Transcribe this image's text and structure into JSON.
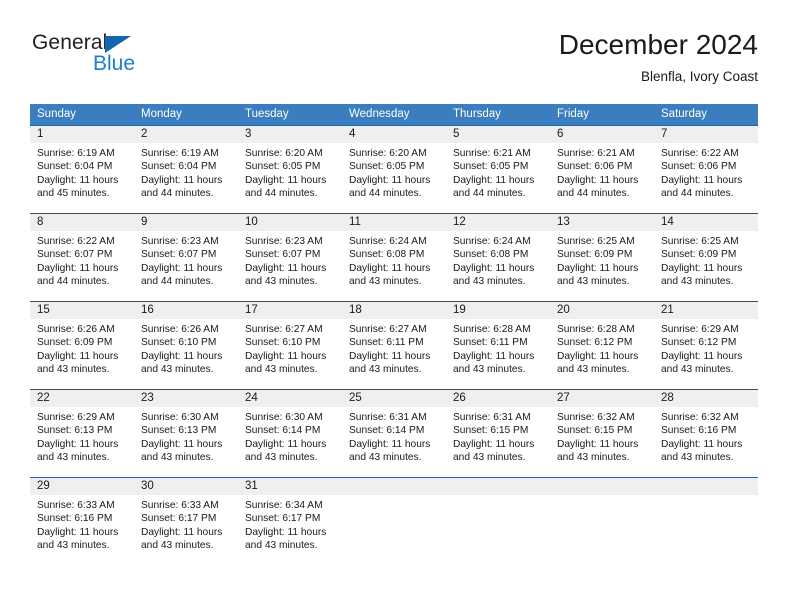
{
  "logo": {
    "text_top": "General",
    "text_bottom": "Blue",
    "triangle_color": "#1266b0",
    "blue_color": "#1b7fd1"
  },
  "header": {
    "title": "December 2024",
    "subtitle": "Blenfla, Ivory Coast"
  },
  "theme": {
    "header_bg": "#3a7ebf",
    "header_text": "#ffffff",
    "daynum_band_bg": "#efefef",
    "rule_color": "#1f69b3"
  },
  "calendar": {
    "weekday_headers": [
      "Sunday",
      "Monday",
      "Tuesday",
      "Wednesday",
      "Thursday",
      "Friday",
      "Saturday"
    ],
    "weeks": [
      [
        {
          "day": "1",
          "sunrise": "Sunrise: 6:19 AM",
          "sunset": "Sunset: 6:04 PM",
          "daylight1": "Daylight: 11 hours",
          "daylight2": "and 45 minutes."
        },
        {
          "day": "2",
          "sunrise": "Sunrise: 6:19 AM",
          "sunset": "Sunset: 6:04 PM",
          "daylight1": "Daylight: 11 hours",
          "daylight2": "and 44 minutes."
        },
        {
          "day": "3",
          "sunrise": "Sunrise: 6:20 AM",
          "sunset": "Sunset: 6:05 PM",
          "daylight1": "Daylight: 11 hours",
          "daylight2": "and 44 minutes."
        },
        {
          "day": "4",
          "sunrise": "Sunrise: 6:20 AM",
          "sunset": "Sunset: 6:05 PM",
          "daylight1": "Daylight: 11 hours",
          "daylight2": "and 44 minutes."
        },
        {
          "day": "5",
          "sunrise": "Sunrise: 6:21 AM",
          "sunset": "Sunset: 6:05 PM",
          "daylight1": "Daylight: 11 hours",
          "daylight2": "and 44 minutes."
        },
        {
          "day": "6",
          "sunrise": "Sunrise: 6:21 AM",
          "sunset": "Sunset: 6:06 PM",
          "daylight1": "Daylight: 11 hours",
          "daylight2": "and 44 minutes."
        },
        {
          "day": "7",
          "sunrise": "Sunrise: 6:22 AM",
          "sunset": "Sunset: 6:06 PM",
          "daylight1": "Daylight: 11 hours",
          "daylight2": "and 44 minutes."
        }
      ],
      [
        {
          "day": "8",
          "sunrise": "Sunrise: 6:22 AM",
          "sunset": "Sunset: 6:07 PM",
          "daylight1": "Daylight: 11 hours",
          "daylight2": "and 44 minutes."
        },
        {
          "day": "9",
          "sunrise": "Sunrise: 6:23 AM",
          "sunset": "Sunset: 6:07 PM",
          "daylight1": "Daylight: 11 hours",
          "daylight2": "and 44 minutes."
        },
        {
          "day": "10",
          "sunrise": "Sunrise: 6:23 AM",
          "sunset": "Sunset: 6:07 PM",
          "daylight1": "Daylight: 11 hours",
          "daylight2": "and 43 minutes."
        },
        {
          "day": "11",
          "sunrise": "Sunrise: 6:24 AM",
          "sunset": "Sunset: 6:08 PM",
          "daylight1": "Daylight: 11 hours",
          "daylight2": "and 43 minutes."
        },
        {
          "day": "12",
          "sunrise": "Sunrise: 6:24 AM",
          "sunset": "Sunset: 6:08 PM",
          "daylight1": "Daylight: 11 hours",
          "daylight2": "and 43 minutes."
        },
        {
          "day": "13",
          "sunrise": "Sunrise: 6:25 AM",
          "sunset": "Sunset: 6:09 PM",
          "daylight1": "Daylight: 11 hours",
          "daylight2": "and 43 minutes."
        },
        {
          "day": "14",
          "sunrise": "Sunrise: 6:25 AM",
          "sunset": "Sunset: 6:09 PM",
          "daylight1": "Daylight: 11 hours",
          "daylight2": "and 43 minutes."
        }
      ],
      [
        {
          "day": "15",
          "sunrise": "Sunrise: 6:26 AM",
          "sunset": "Sunset: 6:09 PM",
          "daylight1": "Daylight: 11 hours",
          "daylight2": "and 43 minutes."
        },
        {
          "day": "16",
          "sunrise": "Sunrise: 6:26 AM",
          "sunset": "Sunset: 6:10 PM",
          "daylight1": "Daylight: 11 hours",
          "daylight2": "and 43 minutes."
        },
        {
          "day": "17",
          "sunrise": "Sunrise: 6:27 AM",
          "sunset": "Sunset: 6:10 PM",
          "daylight1": "Daylight: 11 hours",
          "daylight2": "and 43 minutes."
        },
        {
          "day": "18",
          "sunrise": "Sunrise: 6:27 AM",
          "sunset": "Sunset: 6:11 PM",
          "daylight1": "Daylight: 11 hours",
          "daylight2": "and 43 minutes."
        },
        {
          "day": "19",
          "sunrise": "Sunrise: 6:28 AM",
          "sunset": "Sunset: 6:11 PM",
          "daylight1": "Daylight: 11 hours",
          "daylight2": "and 43 minutes."
        },
        {
          "day": "20",
          "sunrise": "Sunrise: 6:28 AM",
          "sunset": "Sunset: 6:12 PM",
          "daylight1": "Daylight: 11 hours",
          "daylight2": "and 43 minutes."
        },
        {
          "day": "21",
          "sunrise": "Sunrise: 6:29 AM",
          "sunset": "Sunset: 6:12 PM",
          "daylight1": "Daylight: 11 hours",
          "daylight2": "and 43 minutes."
        }
      ],
      [
        {
          "day": "22",
          "sunrise": "Sunrise: 6:29 AM",
          "sunset": "Sunset: 6:13 PM",
          "daylight1": "Daylight: 11 hours",
          "daylight2": "and 43 minutes."
        },
        {
          "day": "23",
          "sunrise": "Sunrise: 6:30 AM",
          "sunset": "Sunset: 6:13 PM",
          "daylight1": "Daylight: 11 hours",
          "daylight2": "and 43 minutes."
        },
        {
          "day": "24",
          "sunrise": "Sunrise: 6:30 AM",
          "sunset": "Sunset: 6:14 PM",
          "daylight1": "Daylight: 11 hours",
          "daylight2": "and 43 minutes."
        },
        {
          "day": "25",
          "sunrise": "Sunrise: 6:31 AM",
          "sunset": "Sunset: 6:14 PM",
          "daylight1": "Daylight: 11 hours",
          "daylight2": "and 43 minutes."
        },
        {
          "day": "26",
          "sunrise": "Sunrise: 6:31 AM",
          "sunset": "Sunset: 6:15 PM",
          "daylight1": "Daylight: 11 hours",
          "daylight2": "and 43 minutes."
        },
        {
          "day": "27",
          "sunrise": "Sunrise: 6:32 AM",
          "sunset": "Sunset: 6:15 PM",
          "daylight1": "Daylight: 11 hours",
          "daylight2": "and 43 minutes."
        },
        {
          "day": "28",
          "sunrise": "Sunrise: 6:32 AM",
          "sunset": "Sunset: 6:16 PM",
          "daylight1": "Daylight: 11 hours",
          "daylight2": "and 43 minutes."
        }
      ],
      [
        {
          "day": "29",
          "sunrise": "Sunrise: 6:33 AM",
          "sunset": "Sunset: 6:16 PM",
          "daylight1": "Daylight: 11 hours",
          "daylight2": "and 43 minutes."
        },
        {
          "day": "30",
          "sunrise": "Sunrise: 6:33 AM",
          "sunset": "Sunset: 6:17 PM",
          "daylight1": "Daylight: 11 hours",
          "daylight2": "and 43 minutes."
        },
        {
          "day": "31",
          "sunrise": "Sunrise: 6:34 AM",
          "sunset": "Sunset: 6:17 PM",
          "daylight1": "Daylight: 11 hours",
          "daylight2": "and 43 minutes."
        },
        {
          "day": "",
          "sunrise": "",
          "sunset": "",
          "daylight1": "",
          "daylight2": ""
        },
        {
          "day": "",
          "sunrise": "",
          "sunset": "",
          "daylight1": "",
          "daylight2": ""
        },
        {
          "day": "",
          "sunrise": "",
          "sunset": "",
          "daylight1": "",
          "daylight2": ""
        },
        {
          "day": "",
          "sunrise": "",
          "sunset": "",
          "daylight1": "",
          "daylight2": ""
        }
      ]
    ]
  }
}
